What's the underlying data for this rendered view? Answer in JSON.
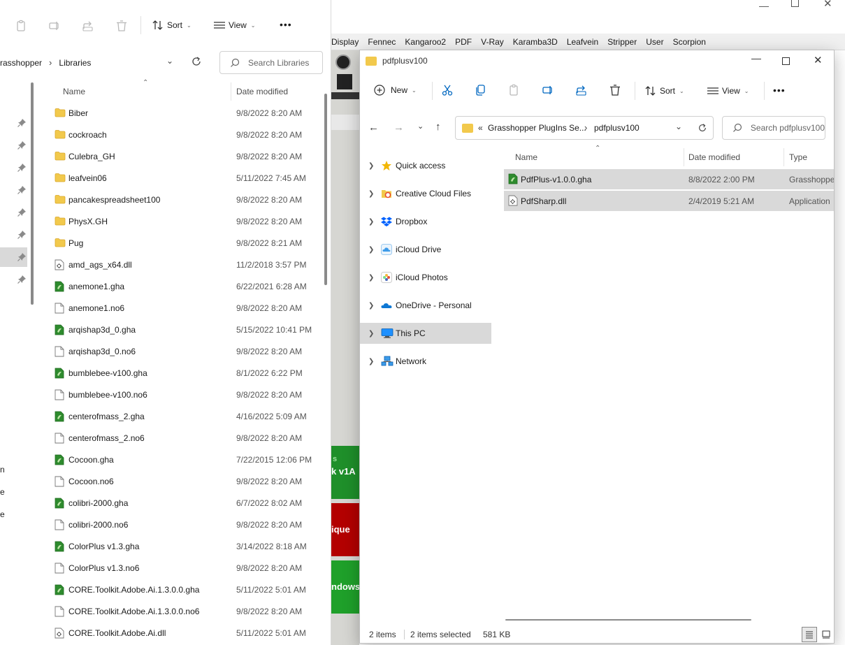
{
  "left_window": {
    "toolbar": {
      "sort_label": "Sort",
      "view_label": "View",
      "more_label": "•••"
    },
    "breadcrumb": [
      "rasshopper",
      "Libraries"
    ],
    "search_placeholder": "Search Libraries",
    "columns": {
      "name": "Name",
      "date": "Date modified"
    },
    "rows": [
      {
        "name": "Biber",
        "date": "9/8/2022 8:20 AM",
        "kind": "folder"
      },
      {
        "name": "cockroach",
        "date": "9/8/2022 8:20 AM",
        "kind": "folder"
      },
      {
        "name": "Culebra_GH",
        "date": "9/8/2022 8:20 AM",
        "kind": "folder"
      },
      {
        "name": "leafvein06",
        "date": "5/11/2022 7:45 AM",
        "kind": "folder"
      },
      {
        "name": "pancakespreadsheet100",
        "date": "9/8/2022 8:20 AM",
        "kind": "folder"
      },
      {
        "name": "PhysX.GH",
        "date": "9/8/2022 8:20 AM",
        "kind": "folder"
      },
      {
        "name": "Pug",
        "date": "9/8/2022 8:21 AM",
        "kind": "folder"
      },
      {
        "name": "amd_ags_x64.dll",
        "date": "11/2/2018 3:57 PM",
        "kind": "dll"
      },
      {
        "name": "anemone1.gha",
        "date": "6/22/2021 6:28 AM",
        "kind": "gha"
      },
      {
        "name": "anemone1.no6",
        "date": "9/8/2022 8:20 AM",
        "kind": "file"
      },
      {
        "name": "arqishap3d_0.gha",
        "date": "5/15/2022 10:41 PM",
        "kind": "gha"
      },
      {
        "name": "arqishap3d_0.no6",
        "date": "9/8/2022 8:20 AM",
        "kind": "file"
      },
      {
        "name": "bumblebee-v100.gha",
        "date": "8/1/2022 6:22 PM",
        "kind": "gha"
      },
      {
        "name": "bumblebee-v100.no6",
        "date": "9/8/2022 8:20 AM",
        "kind": "file"
      },
      {
        "name": "centerofmass_2.gha",
        "date": "4/16/2022 5:09 AM",
        "kind": "gha"
      },
      {
        "name": "centerofmass_2.no6",
        "date": "9/8/2022 8:20 AM",
        "kind": "file"
      },
      {
        "name": "Cocoon.gha",
        "date": "7/22/2015 12:06 PM",
        "kind": "gha"
      },
      {
        "name": "Cocoon.no6",
        "date": "9/8/2022 8:20 AM",
        "kind": "file"
      },
      {
        "name": "colibri-2000.gha",
        "date": "6/7/2022 8:02 AM",
        "kind": "gha"
      },
      {
        "name": "colibri-2000.no6",
        "date": "9/8/2022 8:20 AM",
        "kind": "file"
      },
      {
        "name": "ColorPlus v1.3.gha",
        "date": "3/14/2022 8:18 AM",
        "kind": "gha"
      },
      {
        "name": "ColorPlus v1.3.no6",
        "date": "9/8/2022 8:20 AM",
        "kind": "file"
      },
      {
        "name": "CORE.Toolkit.Adobe.Ai.1.3.0.0.gha",
        "date": "5/11/2022 5:01 AM",
        "kind": "gha"
      },
      {
        "name": "CORE.Toolkit.Adobe.Ai.1.3.0.0.no6",
        "date": "9/8/2022 8:20 AM",
        "kind": "file"
      },
      {
        "name": "CORE.Toolkit.Adobe.Ai.dll",
        "date": "5/11/2022 5:01 AM",
        "kind": "dll"
      }
    ],
    "edge_letters": [
      "n",
      "e",
      "e"
    ]
  },
  "background_app": {
    "menu": [
      "Display",
      "Fennec",
      "Kangaroo2",
      "PDF",
      "V-Ray",
      "Karamba3D",
      "Leafvein",
      "Stripper",
      "User",
      "Scorpion"
    ],
    "tiles": [
      {
        "text": "s",
        "text2": "k v1A",
        "color": "#1f8f2a"
      },
      {
        "text": "ique",
        "color": "#b30000"
      },
      {
        "text": "ndows",
        "color": "#1fa02a"
      }
    ]
  },
  "front_window": {
    "title": "pdfplusv100",
    "toolbar": {
      "new_label": "New",
      "sort_label": "Sort",
      "view_label": "View",
      "more_label": "•••"
    },
    "address": {
      "overflow": "«",
      "segments": [
        "Grasshopper PlugIns Se...",
        "pdfplusv100"
      ]
    },
    "search_placeholder": "Search pdfplusv100",
    "nav": [
      {
        "label": "Quick access",
        "icon": "star-icon"
      },
      {
        "label": "Creative Cloud Files",
        "icon": "creative-cloud-icon"
      },
      {
        "label": "Dropbox",
        "icon": "dropbox-icon"
      },
      {
        "label": "iCloud Drive",
        "icon": "icloud-drive-icon"
      },
      {
        "label": "iCloud Photos",
        "icon": "icloud-photos-icon"
      },
      {
        "label": "OneDrive - Personal",
        "icon": "onedrive-icon"
      },
      {
        "label": "This PC",
        "icon": "this-pc-icon",
        "selected": true
      },
      {
        "label": "Network",
        "icon": "network-icon"
      }
    ],
    "columns": {
      "name": "Name",
      "date": "Date modified",
      "type": "Type"
    },
    "files": [
      {
        "name": "PdfPlus-v1.0.0.gha",
        "date": "8/8/2022 2:00 PM",
        "type": "Grasshopper",
        "kind": "gha"
      },
      {
        "name": "PdfSharp.dll",
        "date": "2/4/2019 5:21 AM",
        "type": "Application",
        "kind": "dll"
      }
    ],
    "status": {
      "count": "2 items",
      "selected": "2 items selected",
      "size": "581 KB"
    }
  },
  "colors": {
    "folder": "#f2c94c",
    "gha": "#2e8b2e",
    "selection": "#d9d9d9",
    "accent": "#0067c0"
  }
}
